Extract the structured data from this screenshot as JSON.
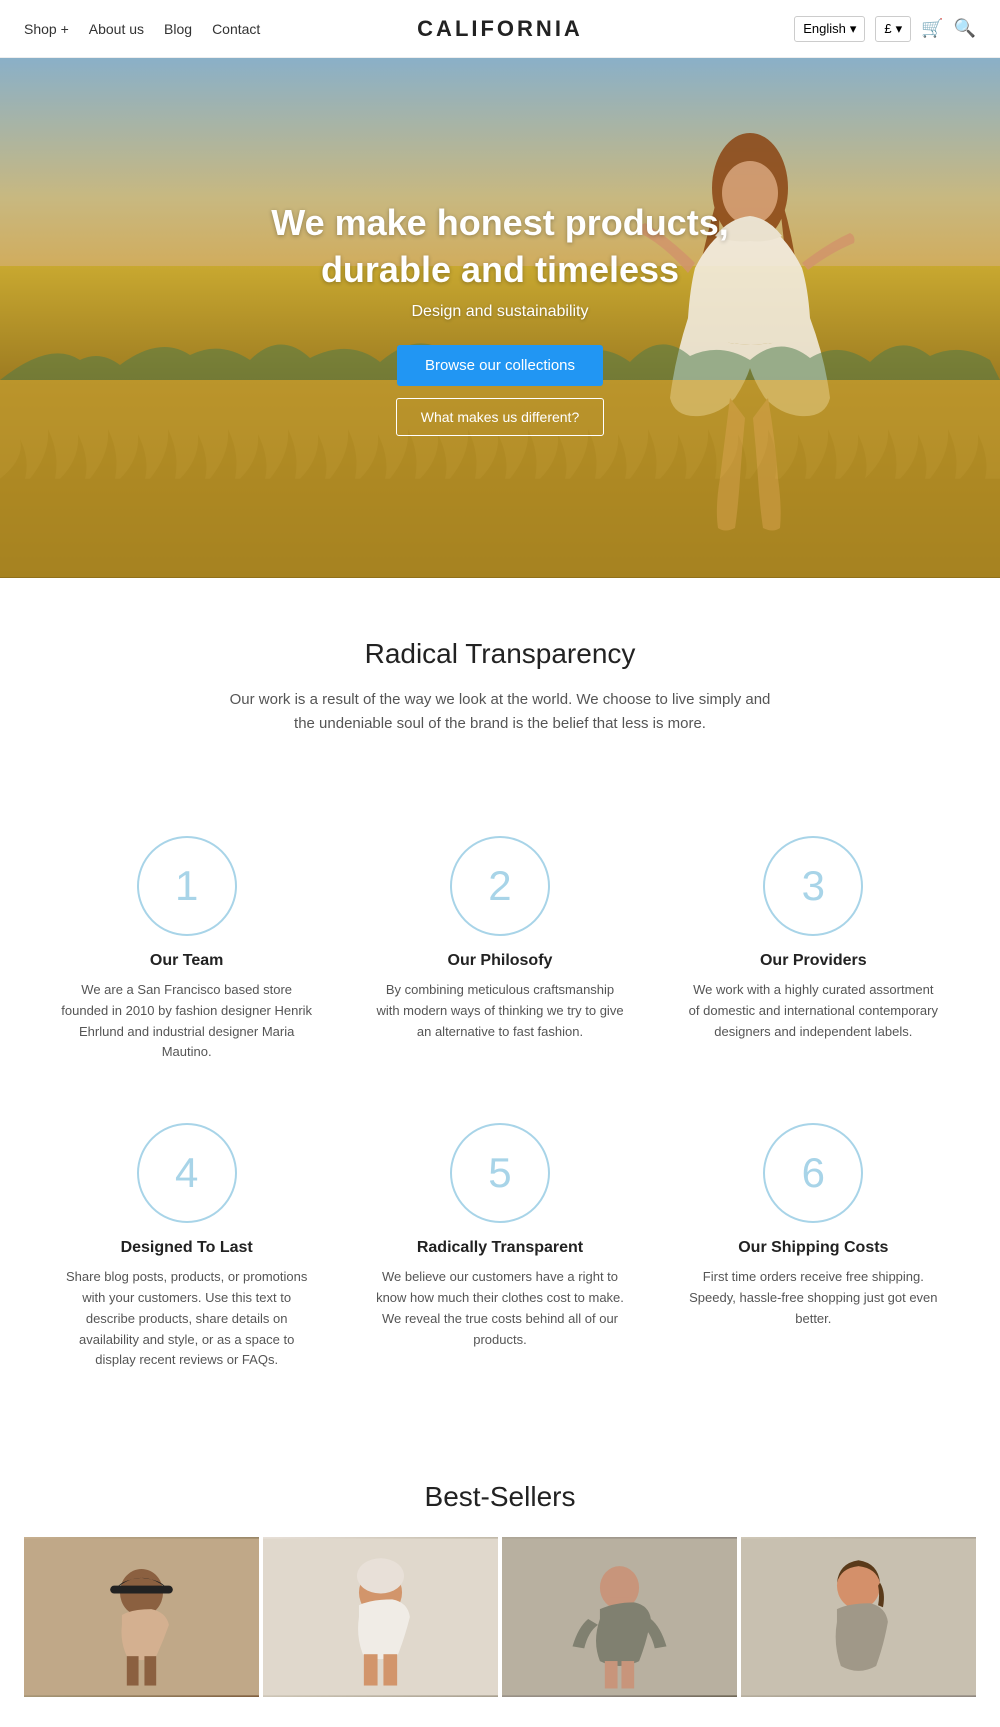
{
  "brand": "CALIFORNIA",
  "navbar": {
    "links": [
      {
        "label": "Shop +",
        "id": "shop"
      },
      {
        "label": "About us",
        "id": "about"
      },
      {
        "label": "Blog",
        "id": "blog"
      },
      {
        "label": "Contact",
        "id": "contact"
      }
    ],
    "language": "English",
    "currency": "£",
    "currency_chevron": "▾"
  },
  "hero": {
    "title": "We make honest products,\ndurable and timeless",
    "subtitle": "Design and sustainability",
    "btn_primary": "Browse our collections",
    "btn_secondary": "What makes us different?"
  },
  "transparency": {
    "title": "Radical Transparency",
    "description": "Our work is a result of the way we look at the world. We choose to live simply and the undeniable soul of the brand is the belief that less is more."
  },
  "features": [
    {
      "number": "1",
      "title": "Our Team",
      "desc": "We are a San Francisco based store founded in 2010 by fashion designer Henrik Ehrlund and industrial designer Maria Mautino."
    },
    {
      "number": "2",
      "title": "Our Philosofy",
      "desc": "By combining meticulous craftsmanship with modern ways of thinking we try to give an alternative to fast fashion."
    },
    {
      "number": "3",
      "title": "Our Providers",
      "desc": "We work with a highly curated assortment of domestic and international contemporary designers and independent labels."
    },
    {
      "number": "4",
      "title": "Designed To Last",
      "desc": "Share blog posts, products, or promotions with your customers. Use this text to describe products, share details on availability and style, or as a space to display recent reviews or FAQs."
    },
    {
      "number": "5",
      "title": "Radically Transparent",
      "desc": "We believe our customers have a right to know how much their clothes cost to make. We reveal the true costs behind all of our products."
    },
    {
      "number": "6",
      "title": "Our Shipping Costs",
      "desc": "First time orders receive free shipping. Speedy, hassle-free shopping just got even better."
    }
  ],
  "bestsellers": {
    "title": "Best-Sellers"
  }
}
